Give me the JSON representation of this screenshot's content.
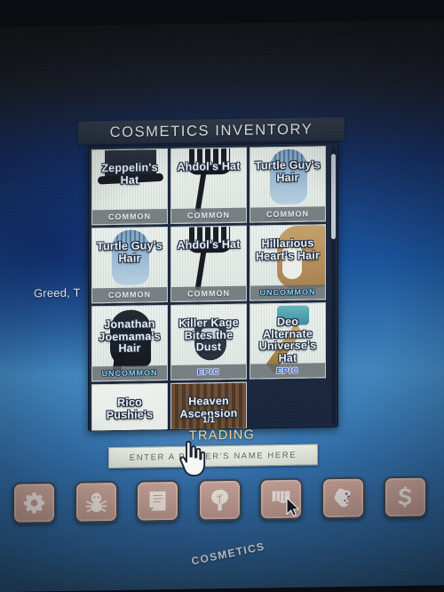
{
  "window": {
    "inventory_title": "COSMETICS INVENTORY"
  },
  "world": {
    "nearby_text": "Greed, T"
  },
  "inventory": {
    "items": [
      {
        "name": "Zeppelin's Hat",
        "rarity": "COMMON",
        "art": "flat-cap"
      },
      {
        "name": "Ahdol's Hat",
        "rarity": "COMMON",
        "art": "spiked-crown"
      },
      {
        "name": "Turtle Guy's Hair",
        "rarity": "COMMON",
        "art": "blue-hair"
      },
      {
        "name": "Turtle Guy's Hair",
        "rarity": "COMMON",
        "art": "blue-hair"
      },
      {
        "name": "Ahdol's Hat",
        "rarity": "COMMON",
        "art": "spiked-crown"
      },
      {
        "name": "Hillarious Heart's Hair",
        "rarity": "UNCOMMON",
        "art": "blonde-hair"
      },
      {
        "name": "Jonathan Joemama's Hair",
        "rarity": "UNCOMMON",
        "art": "black-hair"
      },
      {
        "name": "Killer Kage Bites the Dust",
        "rarity": "EPIC",
        "art": "dark-emblem"
      },
      {
        "name": "Deo Alternate Universe's Hat",
        "rarity": "EPIC",
        "art": "teal-feather"
      },
      {
        "name": "Rico Pushie's",
        "rarity": "",
        "art": "plain"
      },
      {
        "name": "Heaven Ascension",
        "rarity": "",
        "art": "brown-curtain",
        "count": "1/1"
      }
    ]
  },
  "trading": {
    "heading": "TRADING",
    "name_placeholder": "ENTER A PLAYER'S NAME HERE"
  },
  "toolbar": {
    "buttons": [
      {
        "label": "Settings",
        "icon": "gear-icon"
      },
      {
        "label": "Creatures",
        "icon": "spider-icon"
      },
      {
        "label": "Quests",
        "icon": "scroll-icon"
      },
      {
        "label": "Skills",
        "icon": "tree-icon"
      },
      {
        "label": "Banner",
        "icon": "flag-icon"
      },
      {
        "label": "Map",
        "icon": "map-icon"
      },
      {
        "label": "Shop",
        "icon": "dollar-icon"
      }
    ]
  },
  "caption": {
    "cosmetics": "COSMETICS"
  },
  "colors": {
    "accent_gold": "#f0dca0",
    "rarity_common": "#e9eef2",
    "rarity_uncommon": "#8fd4f2",
    "rarity_epic": "#2f56c9"
  }
}
